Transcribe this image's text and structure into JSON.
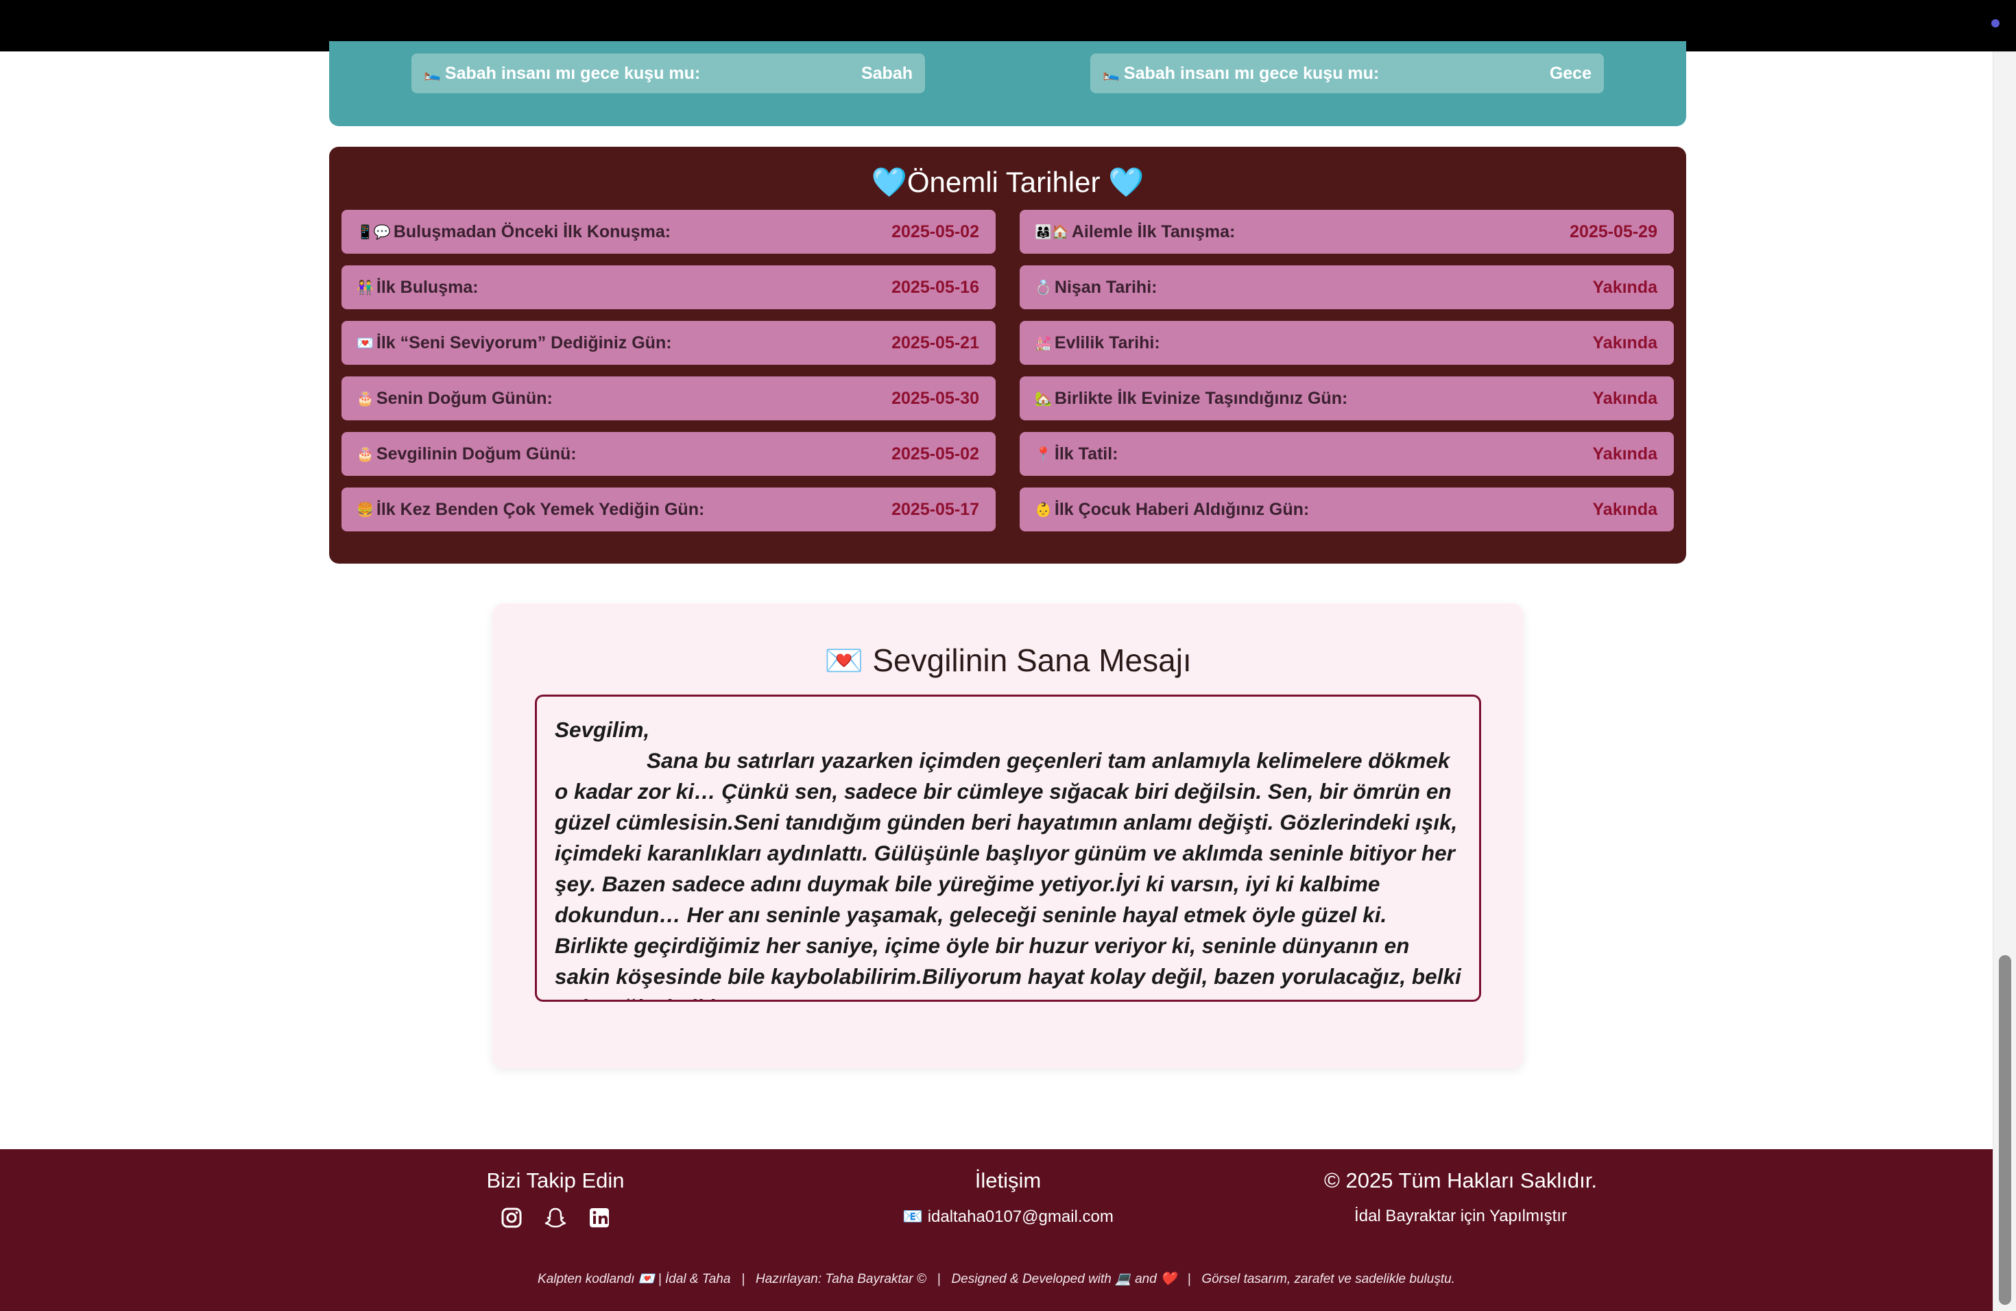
{
  "wake_cards": [
    {
      "label": "Sabah insanı mı gece kuşu mu:",
      "value": "Sabah"
    },
    {
      "label": "Sabah insanı mı gece kuşu mu:",
      "value": "Gece"
    }
  ],
  "important_dates": {
    "title": "Önemli Tarihler",
    "left": [
      {
        "label": "Buluşmadan Önceki İlk Konuşma:",
        "value": "2025-05-02",
        "icon": "📱💬"
      },
      {
        "label": "İlk Buluşma:",
        "value": "2025-05-16",
        "icon": "👫"
      },
      {
        "label": "İlk “Seni Seviyorum” Dediğiniz Gün:",
        "value": "2025-05-21",
        "icon": "💌"
      },
      {
        "label": "Senin Doğum Günün:",
        "value": "2025-05-30",
        "icon": "🎂"
      },
      {
        "label": "Sevgilinin Doğum Günü:",
        "value": "2025-05-02",
        "icon": "🎂"
      },
      {
        "label": "İlk Kez Benden Çok Yemek Yediğin Gün:",
        "value": "2025-05-17",
        "icon": "🍔"
      }
    ],
    "right": [
      {
        "label": "Ailemle İlk Tanışma:",
        "value": "2025-05-29",
        "icon": "👨‍👩‍👧🏠"
      },
      {
        "label": "Nişan Tarihi:",
        "value": "Yakında",
        "icon": "💍"
      },
      {
        "label": "Evlilik Tarihi:",
        "value": "Yakında",
        "icon": "💒"
      },
      {
        "label": "Birlikte İlk Evinize Taşındığınız Gün:",
        "value": "Yakında",
        "icon": "🏡"
      },
      {
        "label": "İlk Tatil:",
        "value": "Yakında",
        "icon": "📍"
      },
      {
        "label": "İlk Çocuk Haberi Aldığınız Gün:",
        "value": "Yakında",
        "icon": "👶"
      }
    ]
  },
  "message": {
    "title": "Sevgilinin Sana Mesajı",
    "greeting": "Sevgilim,",
    "body": "Sana bu satırları yazarken içimden geçenleri tam anlamıyla kelimelere dökmek o kadar zor ki… Çünkü sen, sadece bir cümleye sığacak biri değilsin. Sen, bir ömrün en güzel cümlesisin.Seni tanıdığım günden beri hayatımın anlamı değişti. Gözlerindeki ışık, içimdeki karanlıkları aydınlattı. Gülüşünle başlıyor günüm ve aklımda seninle bitiyor her şey. Bazen sadece adını duymak bile yüreğime yetiyor.İyi ki varsın, iyi ki kalbime dokundun… Her anı seninle yaşamak, geleceği seninle hayal etmek öyle güzel ki. Birlikte geçirdiğimiz her saniye, içime öyle bir huzur veriyor ki, seninle dünyanın en sakin köşesinde bile kaybolabilirim.Biliyorum hayat kolay değil, bazen yorulacağız, belki güleceğiz, belki"
  },
  "footer": {
    "follow_title": "Bizi Takip Edin",
    "contact_title": "İletişim",
    "email": "idaltaha0107@gmail.com",
    "copyright": "© 2025 Tüm Hakları Saklıdır.",
    "made_for": "İdal Bayraktar için Yapılmıştır",
    "credits": "Kalpten kodlandı 💌 | İdal & Taha   |   Hazırlayan: Taha Bayraktar ©   |   Designed & Developed with 💻 and ❤️   |   Görsel tasarım, zarafet ve sadelikle buluştu."
  }
}
